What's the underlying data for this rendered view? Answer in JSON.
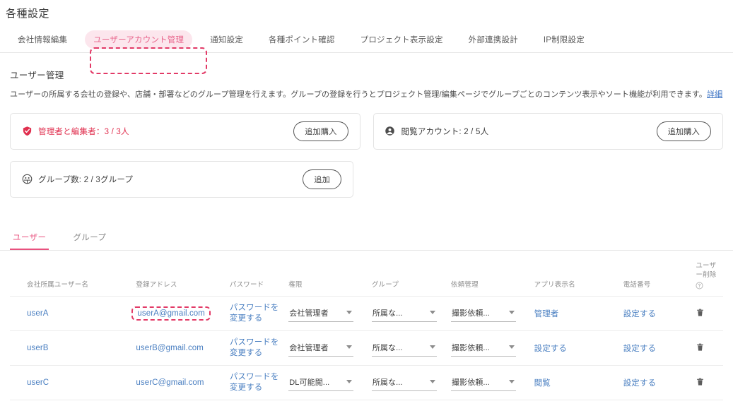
{
  "page": {
    "title": "各種設定"
  },
  "tabs": [
    {
      "label": "会社情報編集",
      "active": false
    },
    {
      "label": "ユーザーアカウント管理",
      "active": true
    },
    {
      "label": "通知設定",
      "active": false
    },
    {
      "label": "各種ポイント確認",
      "active": false
    },
    {
      "label": "プロジェクト表示設定",
      "active": false
    },
    {
      "label": "外部連携設計",
      "active": false
    },
    {
      "label": "IP制限設定",
      "active": false
    }
  ],
  "section": {
    "title": "ユーザー管理",
    "description": "ユーザーの所属する会社の登録や、店舗・部署などのグループ管理を行えます。グループの登録を行うとプロジェクト管理/編集ページでグループごとのコンテンツ表示やソート機能が利用できます。",
    "detail_link": "詳細"
  },
  "cards": [
    {
      "icon": "shield-check-icon",
      "label": "管理者と編集者：3 / 3人",
      "button": "追加購入",
      "style": "danger"
    },
    {
      "icon": "person-icon",
      "label": "閲覧アカウント: 2 / 5人",
      "button": "追加購入",
      "style": "neutral"
    },
    {
      "icon": "group-icon",
      "label": "グループ数: 2 / 3グループ",
      "button": "追加",
      "style": "neutral"
    }
  ],
  "subtabs": [
    {
      "label": "ユーザー",
      "active": true
    },
    {
      "label": "グループ",
      "active": false
    }
  ],
  "table": {
    "headers": [
      "会社所属ユーザー名",
      "登録アドレス",
      "パスワード",
      "権限",
      "グループ",
      "依頼管理",
      "アプリ表示名",
      "電話番号",
      "ユーザー削除"
    ],
    "password_link": "パスワードを変更する",
    "rows": [
      {
        "name": "userA",
        "email": "userA@gmail.com",
        "email_highlighted": true,
        "password": "パスワードを変更する",
        "permission": "会社管理者",
        "group": "所属な...",
        "request": "撮影依頼...",
        "app_name": "管理者",
        "phone": "設定する",
        "delete_icon": "trash-icon"
      },
      {
        "name": "userB",
        "email": "userB@gmail.com",
        "email_highlighted": false,
        "password": "パスワードを変更する",
        "permission": "会社管理者",
        "group": "所属な...",
        "request": "撮影依頼...",
        "app_name": "設定する",
        "phone": "設定する",
        "delete_icon": "trash-icon"
      },
      {
        "name": "userC",
        "email": "userC@gmail.com",
        "email_highlighted": false,
        "password": "パスワードを変更する",
        "permission": "DL可能閲...",
        "group": "所属な...",
        "request": "撮影依頼...",
        "app_name": "閲覧",
        "phone": "設定する",
        "delete_icon": "trash-icon"
      }
    ]
  },
  "colors": {
    "accent_pink": "#e8517e",
    "accent_pink_bg": "#fce6ed",
    "annotation_red": "#e23a67",
    "link_blue": "#4a7fc1",
    "danger_red": "#e0304f"
  }
}
